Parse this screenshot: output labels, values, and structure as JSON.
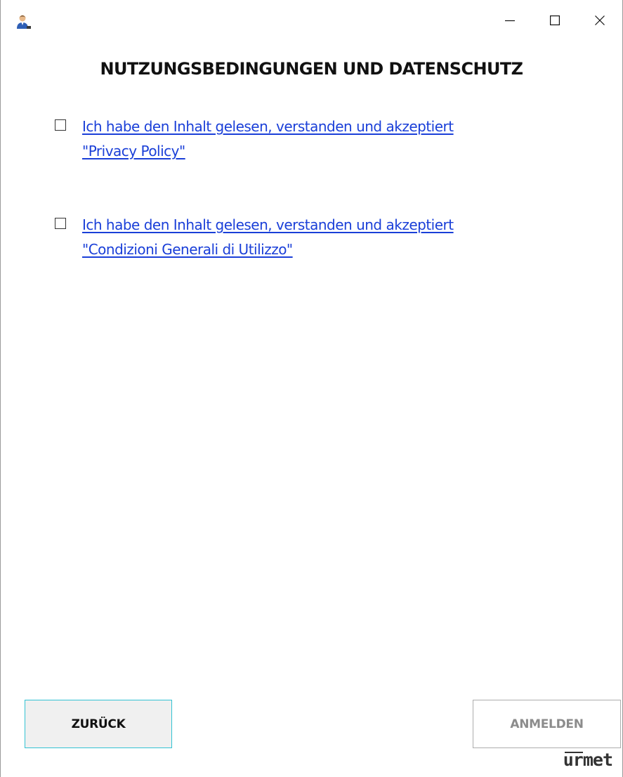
{
  "window": {
    "icon": "user-avatar-icon",
    "controls": {
      "minimize_icon": "minimize-icon",
      "maximize_icon": "maximize-icon",
      "close_icon": "close-icon"
    }
  },
  "page": {
    "title": "NUTZUNGSBEDINGUNGEN UND DATENSCHUTZ"
  },
  "consents": [
    {
      "checked": false,
      "line1": "Ich habe den Inhalt gelesen, verstanden und akzeptiert",
      "line2": "\"Privacy Policy\""
    },
    {
      "checked": false,
      "line1": "Ich habe den Inhalt gelesen, verstanden und akzeptiert",
      "line2": "\"Condizioni Generali di Utilizzo\""
    }
  ],
  "buttons": {
    "back_label": "ZURÜCK",
    "login_label": "ANMELDEN",
    "login_enabled": false
  },
  "brand": {
    "logo_text": "urmet"
  },
  "colors": {
    "link": "#1a3fd8",
    "accent_border": "#33c3d3",
    "disabled_text": "#8c8c8c"
  }
}
